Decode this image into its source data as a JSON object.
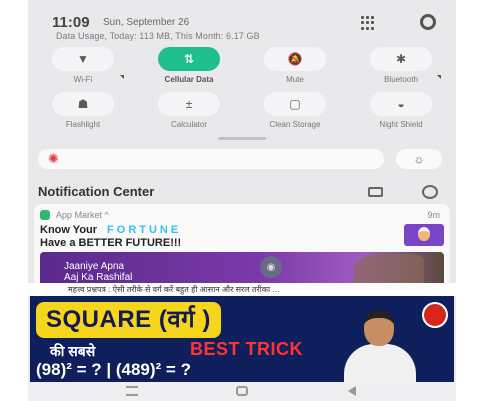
{
  "status": {
    "time": "11:09",
    "date": "Sun, September 26",
    "data_usage": "Data Usage, Today: 113 MB, This Month: 6.17 GB"
  },
  "toggles": [
    {
      "label": "Wi-Fi",
      "icon": "wifi-icon",
      "glyph": "▼",
      "active": false
    },
    {
      "label": "Cellular Data",
      "icon": "cellular-data-icon",
      "glyph": "⇅",
      "active": true
    },
    {
      "label": "Mute",
      "icon": "mute-bell-icon",
      "glyph": "🔕",
      "active": false
    },
    {
      "label": "Bluetooth",
      "icon": "bluetooth-icon",
      "glyph": "✱",
      "active": false
    },
    {
      "label": "Flashlight",
      "icon": "flashlight-icon",
      "glyph": "☗",
      "active": false
    },
    {
      "label": "Calculator",
      "icon": "calculator-icon",
      "glyph": "±",
      "active": false
    },
    {
      "label": "Clean Storage",
      "icon": "clean-storage-icon",
      "glyph": "▢",
      "active": false
    },
    {
      "label": "Night Shield",
      "icon": "night-shield-icon",
      "glyph": "◒",
      "active": false
    }
  ],
  "brightness": {
    "icon": "sun-icon",
    "glyph": "✺",
    "auto_glyph": "☼"
  },
  "notification_center": {
    "title": "Notification Center"
  },
  "notification": {
    "app": "App Market ^",
    "time": "9m",
    "line1": "Know Your",
    "line1_highlight": "FORTUNE",
    "line2": "Have a BETTER FUTURE!!!",
    "banner_line1": "Jaaniye Apna",
    "banner_line2": "Aaj Ka Rashifal",
    "accent": "#31c3e8"
  },
  "hindi_caption": "महत्त्व प्रश्नपत्र : ऐसी तरीके से वर्ग करें बहुत ही आसान और सरल तरीका …",
  "thumbnail": {
    "title": "SQUARE (वर्ग )",
    "line2": "की सबसे",
    "best_trick": "BEST TRICK",
    "equation": "(98)² = ? | (489)² = ?"
  }
}
